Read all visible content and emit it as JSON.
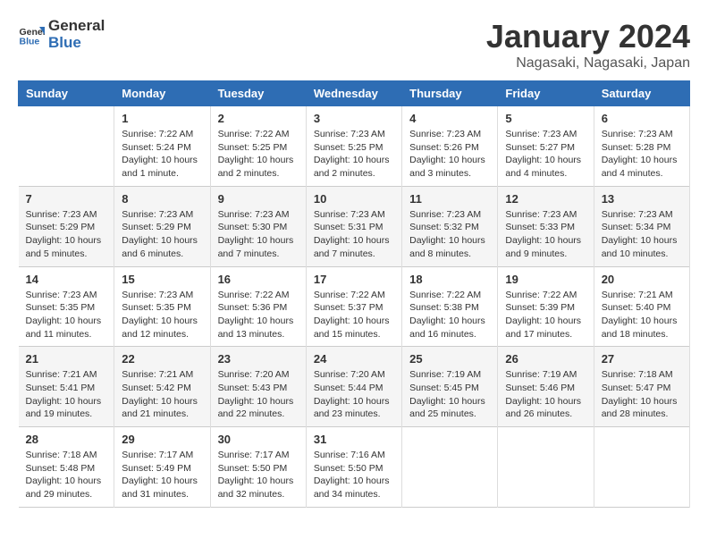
{
  "header": {
    "logo_line1": "General",
    "logo_line2": "Blue",
    "month": "January 2024",
    "location": "Nagasaki, Nagasaki, Japan"
  },
  "columns": [
    "Sunday",
    "Monday",
    "Tuesday",
    "Wednesday",
    "Thursday",
    "Friday",
    "Saturday"
  ],
  "weeks": [
    [
      {
        "day": "",
        "info": ""
      },
      {
        "day": "1",
        "info": "Sunrise: 7:22 AM\nSunset: 5:24 PM\nDaylight: 10 hours\nand 1 minute."
      },
      {
        "day": "2",
        "info": "Sunrise: 7:22 AM\nSunset: 5:25 PM\nDaylight: 10 hours\nand 2 minutes."
      },
      {
        "day": "3",
        "info": "Sunrise: 7:23 AM\nSunset: 5:25 PM\nDaylight: 10 hours\nand 2 minutes."
      },
      {
        "day": "4",
        "info": "Sunrise: 7:23 AM\nSunset: 5:26 PM\nDaylight: 10 hours\nand 3 minutes."
      },
      {
        "day": "5",
        "info": "Sunrise: 7:23 AM\nSunset: 5:27 PM\nDaylight: 10 hours\nand 4 minutes."
      },
      {
        "day": "6",
        "info": "Sunrise: 7:23 AM\nSunset: 5:28 PM\nDaylight: 10 hours\nand 4 minutes."
      }
    ],
    [
      {
        "day": "7",
        "info": "Sunrise: 7:23 AM\nSunset: 5:29 PM\nDaylight: 10 hours\nand 5 minutes."
      },
      {
        "day": "8",
        "info": "Sunrise: 7:23 AM\nSunset: 5:29 PM\nDaylight: 10 hours\nand 6 minutes."
      },
      {
        "day": "9",
        "info": "Sunrise: 7:23 AM\nSunset: 5:30 PM\nDaylight: 10 hours\nand 7 minutes."
      },
      {
        "day": "10",
        "info": "Sunrise: 7:23 AM\nSunset: 5:31 PM\nDaylight: 10 hours\nand 7 minutes."
      },
      {
        "day": "11",
        "info": "Sunrise: 7:23 AM\nSunset: 5:32 PM\nDaylight: 10 hours\nand 8 minutes."
      },
      {
        "day": "12",
        "info": "Sunrise: 7:23 AM\nSunset: 5:33 PM\nDaylight: 10 hours\nand 9 minutes."
      },
      {
        "day": "13",
        "info": "Sunrise: 7:23 AM\nSunset: 5:34 PM\nDaylight: 10 hours\nand 10 minutes."
      }
    ],
    [
      {
        "day": "14",
        "info": "Sunrise: 7:23 AM\nSunset: 5:35 PM\nDaylight: 10 hours\nand 11 minutes."
      },
      {
        "day": "15",
        "info": "Sunrise: 7:23 AM\nSunset: 5:35 PM\nDaylight: 10 hours\nand 12 minutes."
      },
      {
        "day": "16",
        "info": "Sunrise: 7:22 AM\nSunset: 5:36 PM\nDaylight: 10 hours\nand 13 minutes."
      },
      {
        "day": "17",
        "info": "Sunrise: 7:22 AM\nSunset: 5:37 PM\nDaylight: 10 hours\nand 15 minutes."
      },
      {
        "day": "18",
        "info": "Sunrise: 7:22 AM\nSunset: 5:38 PM\nDaylight: 10 hours\nand 16 minutes."
      },
      {
        "day": "19",
        "info": "Sunrise: 7:22 AM\nSunset: 5:39 PM\nDaylight: 10 hours\nand 17 minutes."
      },
      {
        "day": "20",
        "info": "Sunrise: 7:21 AM\nSunset: 5:40 PM\nDaylight: 10 hours\nand 18 minutes."
      }
    ],
    [
      {
        "day": "21",
        "info": "Sunrise: 7:21 AM\nSunset: 5:41 PM\nDaylight: 10 hours\nand 19 minutes."
      },
      {
        "day": "22",
        "info": "Sunrise: 7:21 AM\nSunset: 5:42 PM\nDaylight: 10 hours\nand 21 minutes."
      },
      {
        "day": "23",
        "info": "Sunrise: 7:20 AM\nSunset: 5:43 PM\nDaylight: 10 hours\nand 22 minutes."
      },
      {
        "day": "24",
        "info": "Sunrise: 7:20 AM\nSunset: 5:44 PM\nDaylight: 10 hours\nand 23 minutes."
      },
      {
        "day": "25",
        "info": "Sunrise: 7:19 AM\nSunset: 5:45 PM\nDaylight: 10 hours\nand 25 minutes."
      },
      {
        "day": "26",
        "info": "Sunrise: 7:19 AM\nSunset: 5:46 PM\nDaylight: 10 hours\nand 26 minutes."
      },
      {
        "day": "27",
        "info": "Sunrise: 7:18 AM\nSunset: 5:47 PM\nDaylight: 10 hours\nand 28 minutes."
      }
    ],
    [
      {
        "day": "28",
        "info": "Sunrise: 7:18 AM\nSunset: 5:48 PM\nDaylight: 10 hours\nand 29 minutes."
      },
      {
        "day": "29",
        "info": "Sunrise: 7:17 AM\nSunset: 5:49 PM\nDaylight: 10 hours\nand 31 minutes."
      },
      {
        "day": "30",
        "info": "Sunrise: 7:17 AM\nSunset: 5:50 PM\nDaylight: 10 hours\nand 32 minutes."
      },
      {
        "day": "31",
        "info": "Sunrise: 7:16 AM\nSunset: 5:50 PM\nDaylight: 10 hours\nand 34 minutes."
      },
      {
        "day": "",
        "info": ""
      },
      {
        "day": "",
        "info": ""
      },
      {
        "day": "",
        "info": ""
      }
    ]
  ]
}
